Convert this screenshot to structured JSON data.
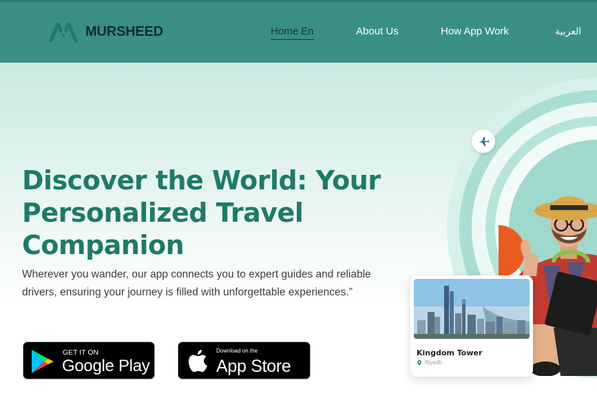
{
  "brand": {
    "name": "MURSHEED",
    "logo_icon": "mursheed-m-logo"
  },
  "nav": {
    "home": "Home En",
    "about": "About Us",
    "how": "How App Work",
    "lang": "العربية"
  },
  "hero": {
    "title": "Discover the World: Your Personalized Travel Companion",
    "description": "Wherever you wander, our app connects you to expert guides and reliable drivers, ensuring your journey is filled with unforgettable experiences.”"
  },
  "stores": {
    "google": {
      "small": "GET IT ON",
      "big": "Google Play",
      "icon": "google-play-icon"
    },
    "apple": {
      "small": "Download on the",
      "big": "App Store",
      "icon": "apple-icon"
    }
  },
  "place_card": {
    "name": "Kingdom Tower",
    "location": "Riyadh",
    "icon": "location-pin-icon"
  },
  "colors": {
    "header": "#3b8f80",
    "accent": "#1f7a68",
    "ring": "#a8ddd4",
    "orange": "#e85d1f"
  }
}
